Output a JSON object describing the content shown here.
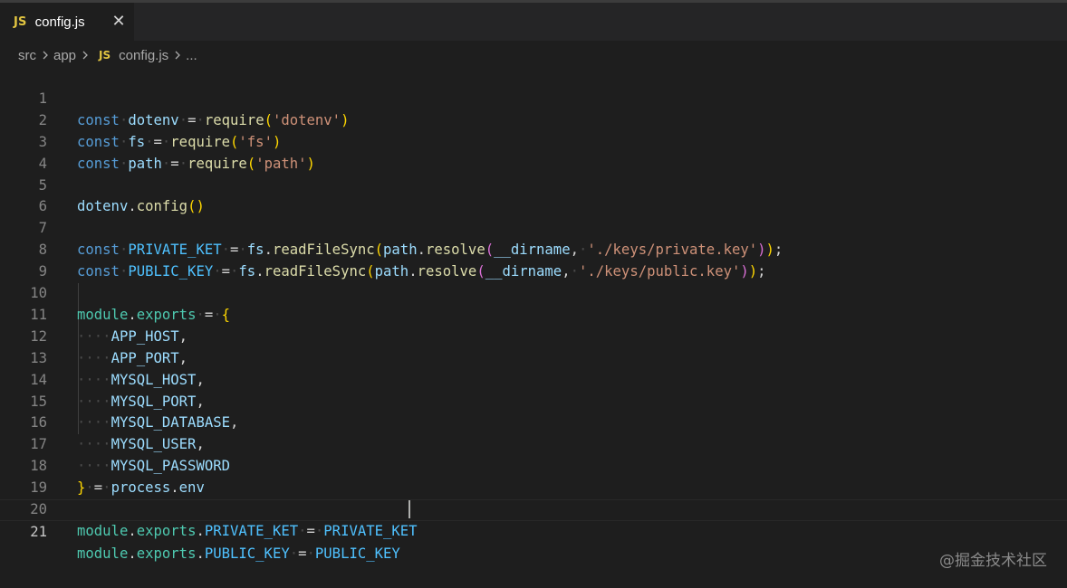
{
  "tab": {
    "badge": "JS",
    "label": "config.js",
    "close": "✕"
  },
  "breadcrumb": {
    "part1": "src",
    "part2": "app",
    "badge": "JS",
    "file": "config.js",
    "rest": "..."
  },
  "code": {
    "kw_const": "const",
    "kw_require": "require",
    "v_dotenv": "dotenv",
    "v_fs": "fs",
    "v_path": "path",
    "s_dotenv": "'dotenv'",
    "s_fs": "'fs'",
    "s_path": "'path'",
    "f_config": "config",
    "c_private": "PRIVATE_KET",
    "c_public": "PUBLIC_KEY",
    "f_readFileSync": "readFileSync",
    "f_resolve": "resolve",
    "v_dirname": "__dirname",
    "s_private_key": "'./keys/private.key'",
    "s_public_key": "'./keys/public.key'",
    "m_module": "module",
    "m_exports": "exports",
    "v_app_host": "APP_HOST",
    "v_app_port": "APP_PORT",
    "v_mysql_host": "MYSQL_HOST",
    "v_mysql_port": "MYSQL_PORT",
    "v_mysql_database": "MYSQL_DATABASE",
    "v_mysql_user": "MYSQL_USER",
    "v_mysql_password": "MYSQL_PASSWORD",
    "v_process": "process",
    "v_env": "env",
    "v_private_ket": "PRIVATE_KET",
    "v_public_key": "PUBLIC_KEY"
  },
  "line_numbers": [
    "1",
    "2",
    "3",
    "4",
    "5",
    "6",
    "7",
    "8",
    "9",
    "10",
    "11",
    "12",
    "13",
    "14",
    "15",
    "16",
    "17",
    "18",
    "19",
    "20",
    "21"
  ],
  "watermark": "@掘金技术社区"
}
